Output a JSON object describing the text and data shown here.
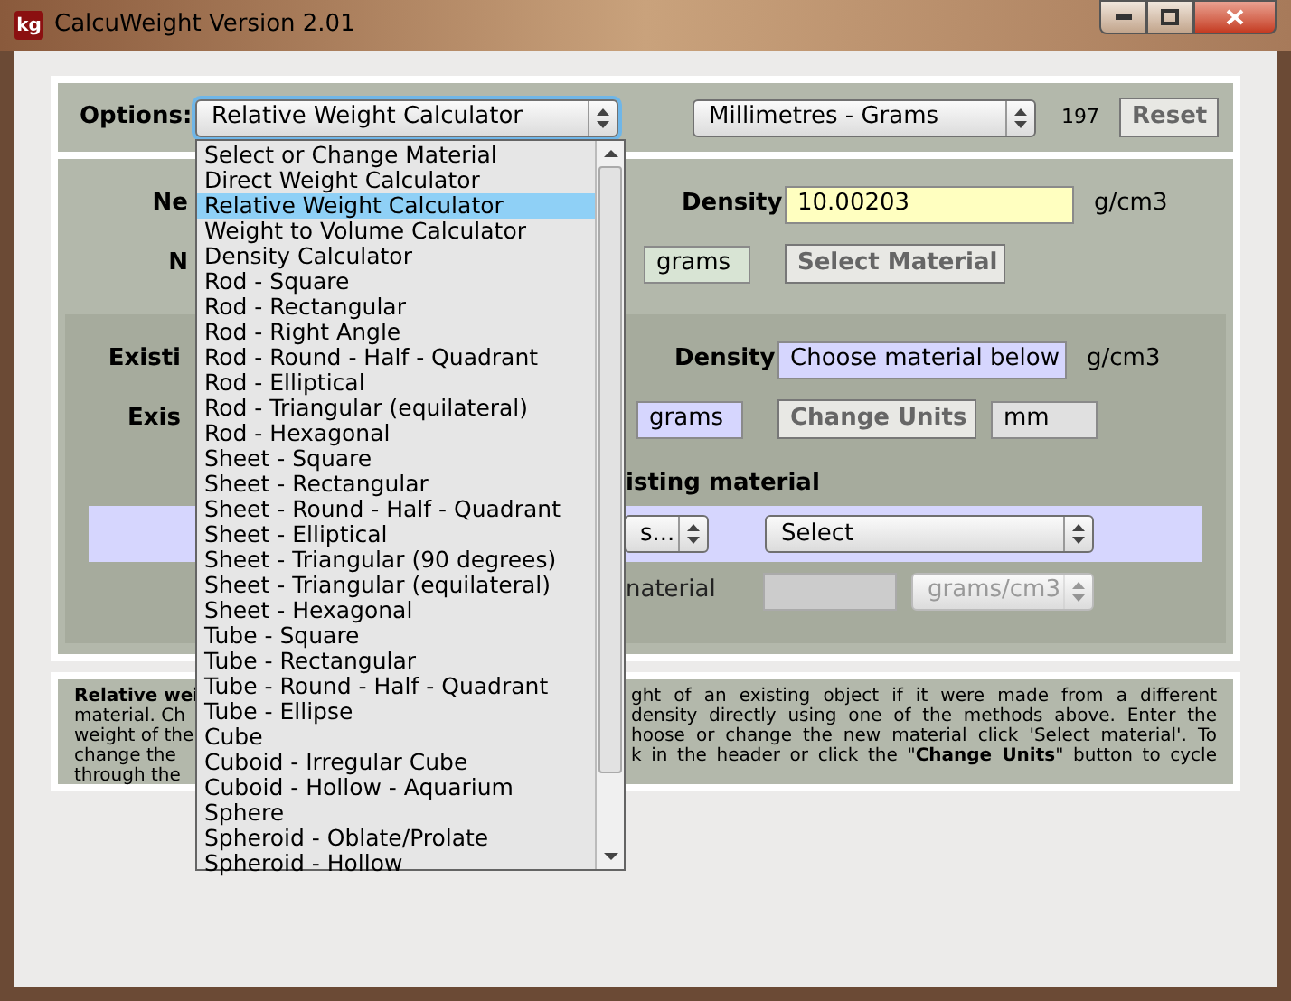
{
  "window": {
    "title": "CalcuWeight Version 2.01",
    "app_icon_text": "kg"
  },
  "options_bar": {
    "label": "Options:",
    "calculator_select": "Relative Weight Calculator",
    "units_select": "Millimetres - Grams",
    "count": "197",
    "reset_button": "Reset"
  },
  "dropdown": {
    "items": [
      {
        "label": "Select or Change Material",
        "selected": false
      },
      {
        "label": "Direct Weight Calculator",
        "selected": false
      },
      {
        "label": "Relative Weight Calculator",
        "selected": true
      },
      {
        "label": "Weight to Volume Calculator",
        "selected": false
      },
      {
        "label": "Density Calculator",
        "selected": false
      },
      {
        "label": "Rod - Square",
        "selected": false
      },
      {
        "label": "Rod - Rectangular",
        "selected": false
      },
      {
        "label": "Rod - Right Angle",
        "selected": false
      },
      {
        "label": "Rod - Round - Half - Quadrant",
        "selected": false
      },
      {
        "label": "Rod - Elliptical",
        "selected": false
      },
      {
        "label": "Rod - Triangular (equilateral)",
        "selected": false
      },
      {
        "label": "Rod - Hexagonal",
        "selected": false
      },
      {
        "label": "Sheet - Square",
        "selected": false
      },
      {
        "label": "Sheet - Rectangular",
        "selected": false
      },
      {
        "label": "Sheet - Round - Half - Quadrant",
        "selected": false
      },
      {
        "label": "Sheet - Elliptical",
        "selected": false
      },
      {
        "label": "Sheet - Triangular (90 degrees)",
        "selected": false
      },
      {
        "label": "Sheet - Triangular (equilateral)",
        "selected": false
      },
      {
        "label": "Sheet - Hexagonal",
        "selected": false
      },
      {
        "label": "Tube - Square",
        "selected": false
      },
      {
        "label": "Tube - Rectangular",
        "selected": false
      },
      {
        "label": "Tube - Round - Half - Quadrant",
        "selected": false
      },
      {
        "label": "Tube - Ellipse",
        "selected": false
      },
      {
        "label": "Cube",
        "selected": false
      },
      {
        "label": "Cuboid - Irregular Cube",
        "selected": false
      },
      {
        "label": "Cuboid - Hollow - Aquarium",
        "selected": false
      },
      {
        "label": "Sphere",
        "selected": false
      },
      {
        "label": "Spheroid - Oblate/Prolate",
        "selected": false
      },
      {
        "label": "Spheroid - Hollow",
        "selected": false
      }
    ]
  },
  "new_material": {
    "label_fragments": [
      "Ne",
      "N"
    ],
    "density_label": "Density",
    "density_value": "10.00203",
    "density_unit": "g/cm3",
    "weight_unit": "grams",
    "select_button": "Select Material"
  },
  "existing_material": {
    "label_fragments": [
      "Existi",
      "Exis"
    ],
    "density_label": "Density",
    "density_value": "Choose material below",
    "density_unit": "g/cm3",
    "weight_unit": "grams",
    "change_units_button": "Change Units",
    "length_unit": "mm",
    "heading_fragment": "isting material",
    "category_select": "s...",
    "material_select": "Select",
    "custom_label_fragment": "naterial",
    "custom_unit_select": "grams/cm3",
    "custom_disabled": true
  },
  "description": {
    "left_lines": [
      "Relative wei",
      "material. Ch",
      "weight of the",
      "change the",
      "through the"
    ],
    "right_lines": [
      "ght of an existing object if it were made from a different",
      "density directly using one of the methods above. Enter the",
      "hoose or change the new material click 'Select material'. To",
      "k in the header or click the \"**Change Units**\" button to cycle"
    ]
  }
}
